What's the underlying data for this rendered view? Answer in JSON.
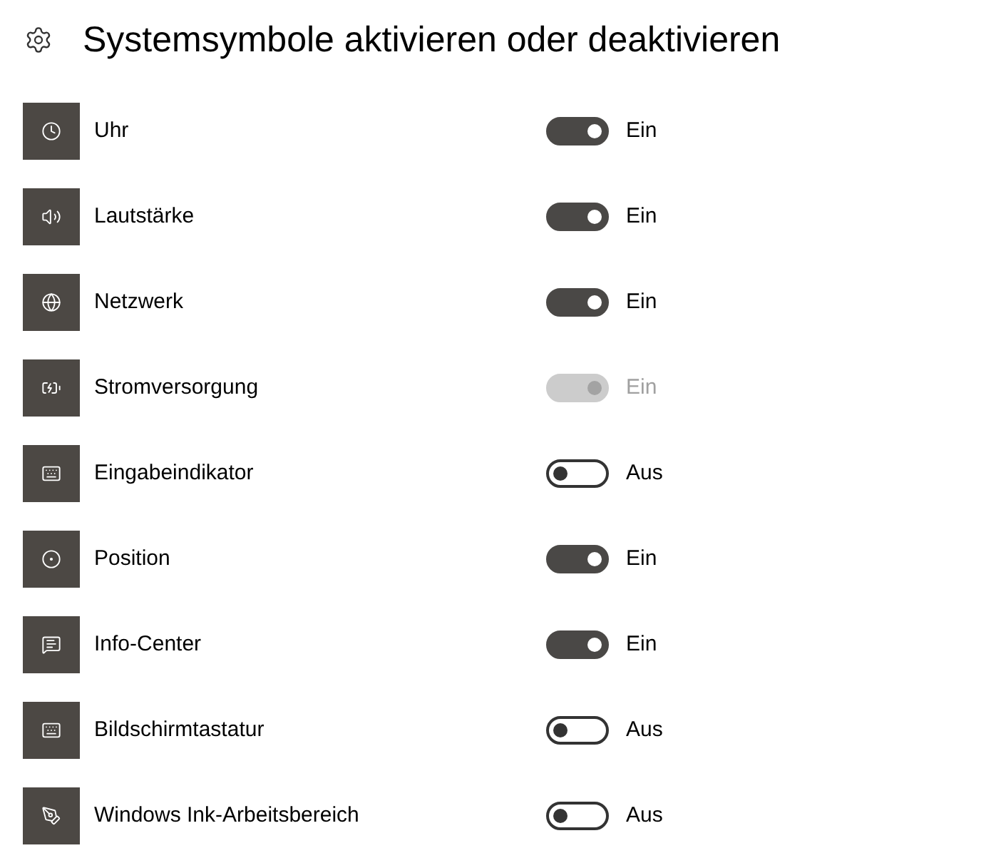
{
  "header": {
    "title": "Systemsymbole aktivieren oder deaktivieren"
  },
  "rows": [
    {
      "label": "Uhr",
      "on": true,
      "disabled": false,
      "status": "Ein"
    },
    {
      "label": "Lautstärke",
      "on": true,
      "disabled": false,
      "status": "Ein"
    },
    {
      "label": "Netzwerk",
      "on": true,
      "disabled": false,
      "status": "Ein"
    },
    {
      "label": "Stromversorgung",
      "on": true,
      "disabled": true,
      "status": "Ein"
    },
    {
      "label": "Eingabeindikator",
      "on": false,
      "disabled": false,
      "status": "Aus"
    },
    {
      "label": "Position",
      "on": true,
      "disabled": false,
      "status": "Ein"
    },
    {
      "label": "Info-Center",
      "on": true,
      "disabled": false,
      "status": "Ein"
    },
    {
      "label": "Bildschirmtastatur",
      "on": false,
      "disabled": false,
      "status": "Aus"
    },
    {
      "label": "Windows Ink-Arbeitsbereich",
      "on": false,
      "disabled": false,
      "status": "Aus"
    }
  ]
}
